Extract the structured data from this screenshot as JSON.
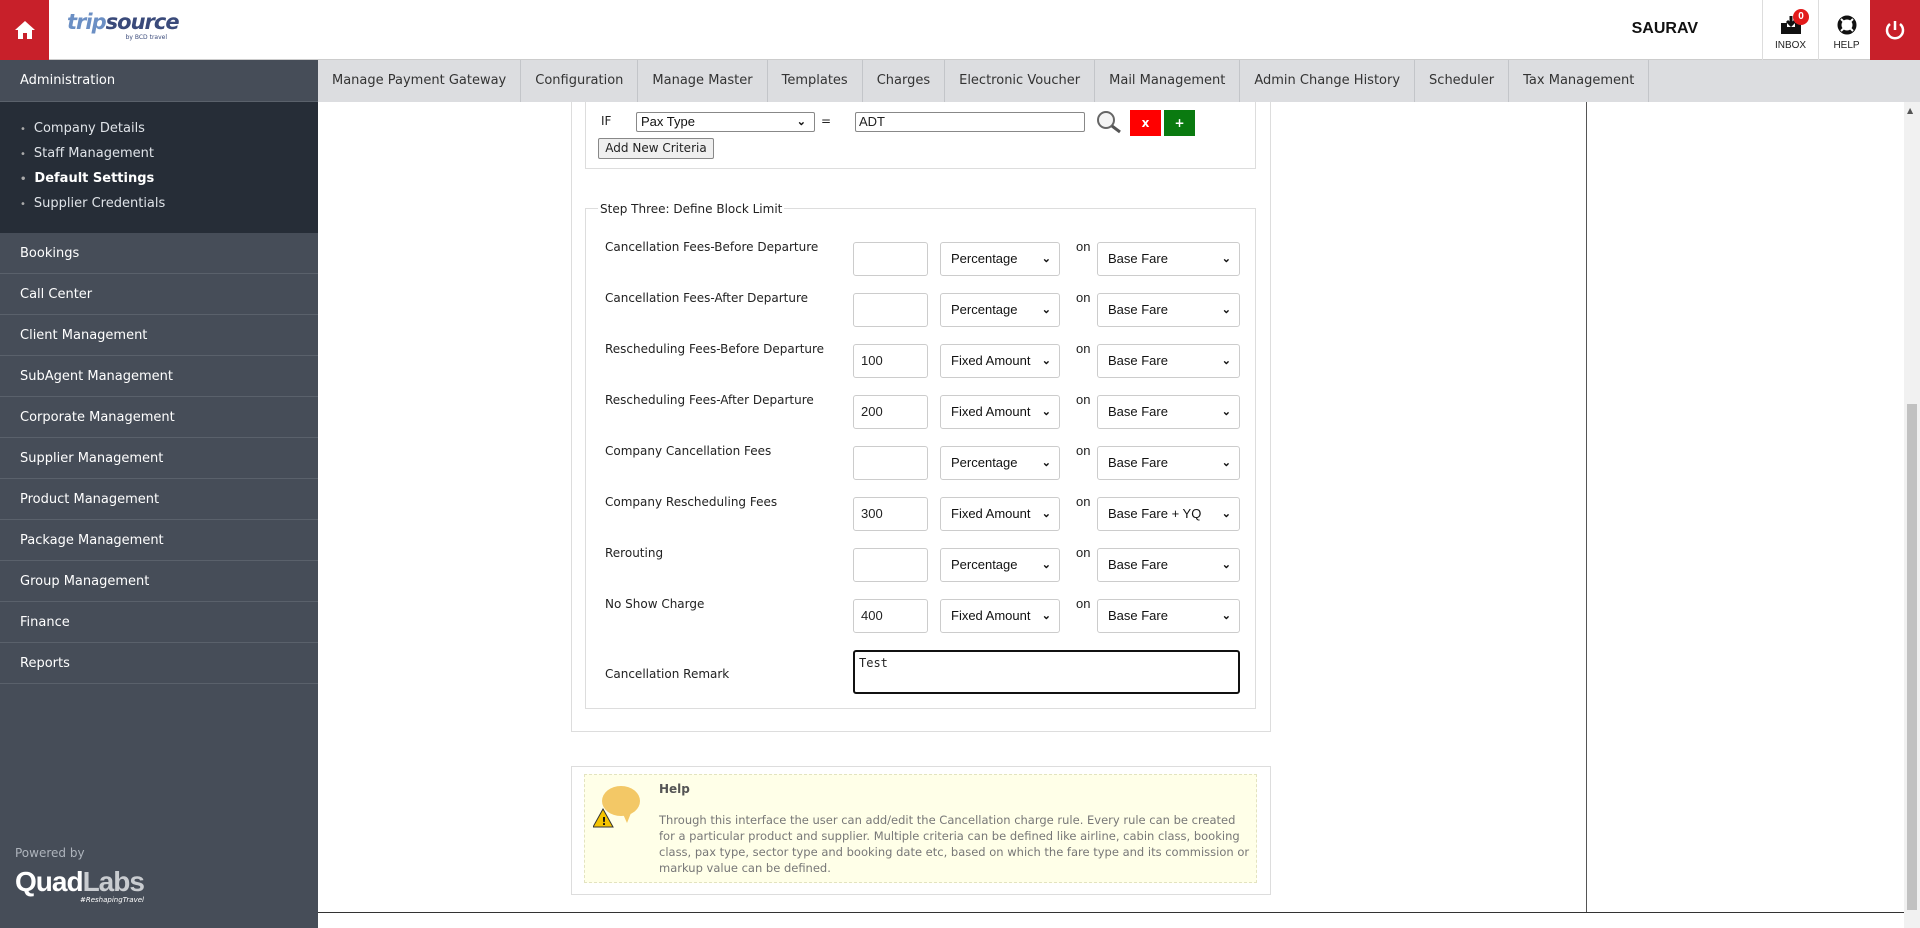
{
  "header": {
    "logo": "tripsource",
    "logo_sub": "by BCD travel",
    "user": "SAURAV",
    "inbox_label": "INBOX",
    "inbox_count": "0",
    "help_label": "HELP"
  },
  "sidebar": {
    "section": "Administration",
    "submenu": [
      "Company Details",
      "Staff Management",
      "Default Settings",
      "Supplier Credentials"
    ],
    "active": "Default Settings",
    "items": [
      "Bookings",
      "Call Center",
      "Client Management",
      "SubAgent Management",
      "Corporate Management",
      "Supplier Management",
      "Product Management",
      "Package Management",
      "Group Management",
      "Finance",
      "Reports"
    ],
    "powered_by": "Powered by",
    "brand": "QuadLabs",
    "brand_tag": "#ReshapingTravel"
  },
  "tabs": [
    "Manage Payment Gateway",
    "Configuration",
    "Manage Master",
    "Templates",
    "Charges",
    "Electronic Voucher",
    "Mail Management",
    "Admin Change History",
    "Scheduler",
    "Tax Management"
  ],
  "criteria": {
    "if_label": "IF",
    "field": "Pax Type",
    "eq": "=",
    "value": "ADT",
    "remove": "x",
    "add": "+",
    "add_new": "Add New Criteria"
  },
  "step_three": {
    "legend": "Step Three: Define Block Limit",
    "on_label": "on",
    "rows": [
      {
        "label": "Cancellation Fees-Before Departure",
        "value": "",
        "type": "Percentage",
        "base": "Base Fare"
      },
      {
        "label": "Cancellation Fees-After Departure",
        "value": "",
        "type": "Percentage",
        "base": "Base Fare"
      },
      {
        "label": "Rescheduling Fees-Before Departure",
        "value": "100",
        "type": "Fixed Amount",
        "base": "Base Fare"
      },
      {
        "label": "Rescheduling Fees-After Departure",
        "value": "200",
        "type": "Fixed Amount",
        "base": "Base Fare"
      },
      {
        "label": "Company Cancellation Fees",
        "value": "",
        "type": "Percentage",
        "base": "Base Fare"
      },
      {
        "label": "Company Rescheduling Fees",
        "value": "300",
        "type": "Fixed Amount",
        "base": "Base Fare + YQ"
      },
      {
        "label": "Rerouting",
        "value": "",
        "type": "Percentage",
        "base": "Base Fare"
      },
      {
        "label": "No Show Charge",
        "value": "400",
        "type": "Fixed Amount",
        "base": "Base Fare"
      }
    ],
    "remark_label": "Cancellation Remark",
    "remark_value": "Test"
  },
  "help": {
    "title": "Help",
    "text": "Through this interface the user can add/edit the Cancellation charge rule. Every rule can be created for a particular product and supplier. Multiple criteria can be defined like airline, cabin class, booking class, pax type, sector type and booking date etc, based on which the fare type and its commission or markup value can be defined."
  }
}
